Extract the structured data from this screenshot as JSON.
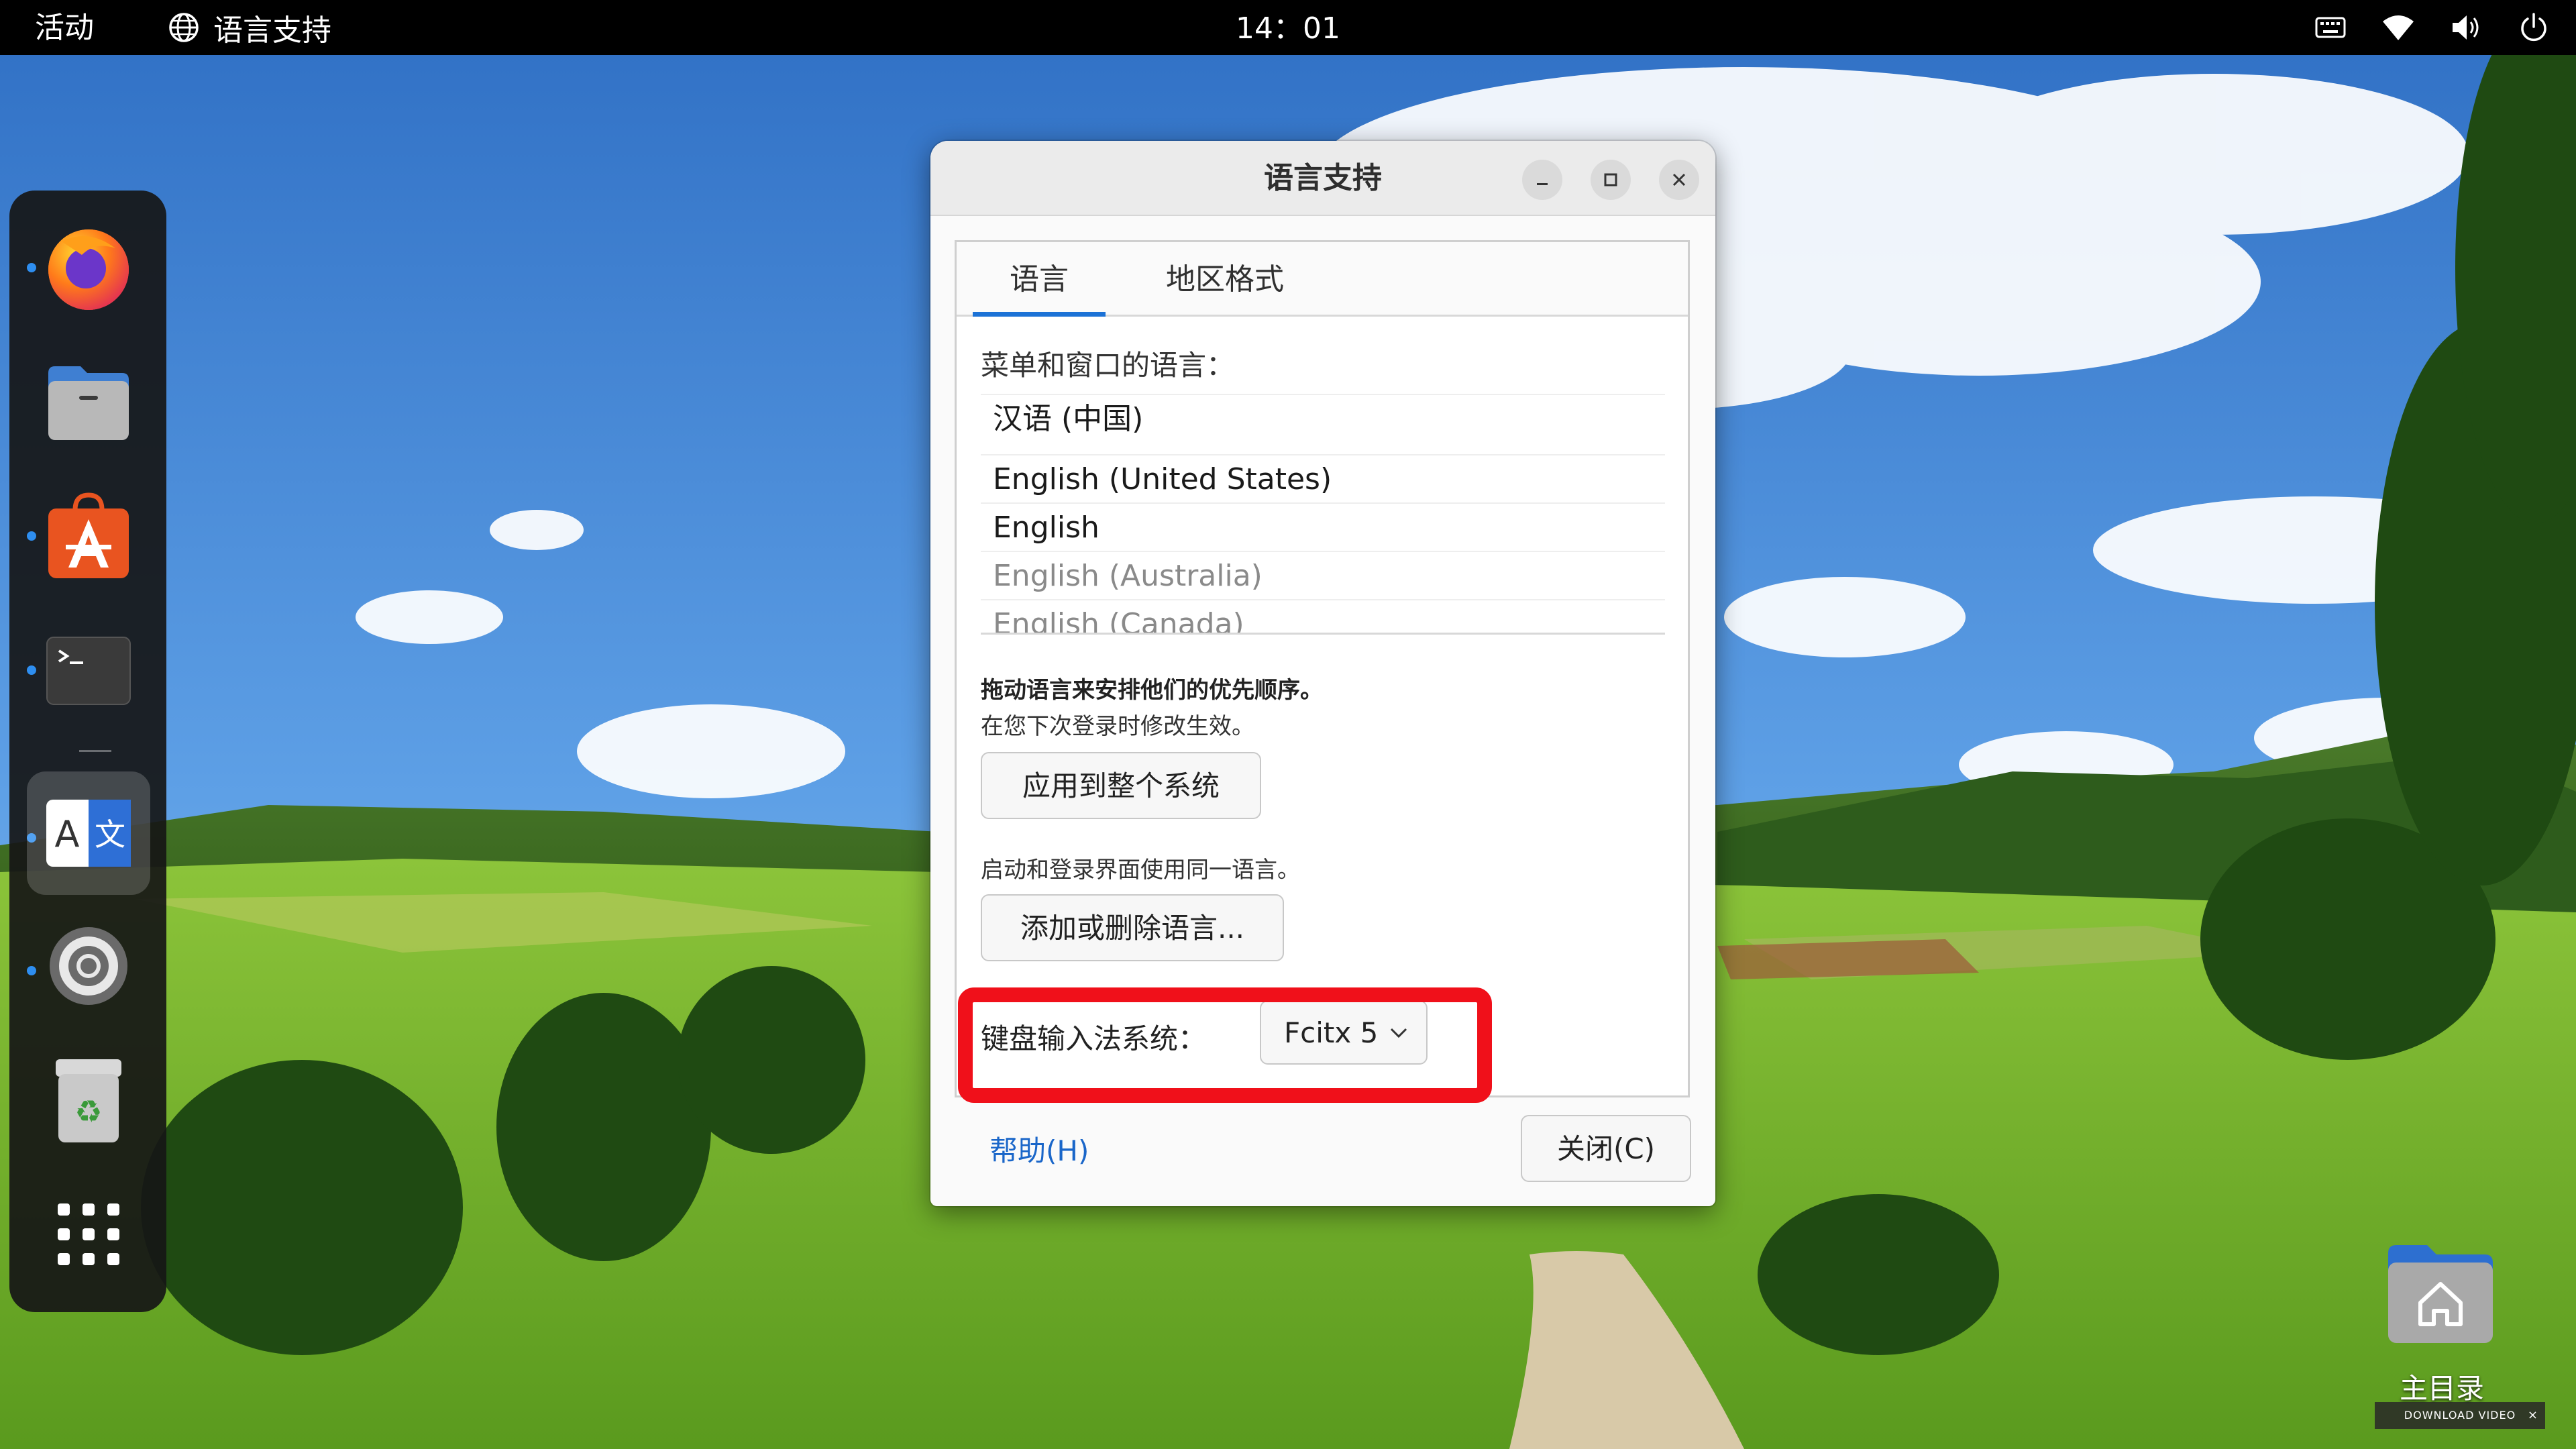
{
  "topbar": {
    "activities": "活动",
    "app_name": "语言支持",
    "clock": "14：01"
  },
  "dock": {
    "apps": [
      {
        "name": "Firefox",
        "icon": "firefox-icon",
        "running": true
      },
      {
        "name": "文件",
        "icon": "files-icon",
        "running": false
      },
      {
        "name": "Ubuntu Software",
        "icon": "app-store-icon",
        "running": true
      },
      {
        "name": "终端",
        "icon": "terminal-icon",
        "running": true
      },
      {
        "name": "语言支持",
        "icon": "language-icon",
        "running": true,
        "active": true
      },
      {
        "name": "设置",
        "icon": "settings-icon",
        "running": true
      },
      {
        "name": "回收站",
        "icon": "trash-icon",
        "running": false
      },
      {
        "name": "显示应用程序",
        "icon": "app-grid-icon",
        "running": false
      }
    ]
  },
  "dialog": {
    "title": "语言支持",
    "tabs": [
      {
        "label": "语言",
        "active": true
      },
      {
        "label": "地区格式",
        "active": false
      }
    ],
    "menu_language_label": "菜单和窗口的语言：",
    "languages": [
      {
        "name": "汉语 (中国)",
        "dim": false
      },
      {
        "name": "English (United States)",
        "dim": false
      },
      {
        "name": "English",
        "dim": false
      },
      {
        "name": "English (Australia)",
        "dim": true
      },
      {
        "name": "English (Canada)",
        "dim": true
      }
    ],
    "drag_hint": "拖动语言来安排他们的优先顺序。",
    "next_login_hint": "在您下次登录时修改生效。",
    "apply_system_button": "应用到整个系统",
    "login_screen_hint": "启动和登录界面使用同一语言。",
    "add_remove_button": "添加或删除语言...",
    "ime_label": "键盘输入法系统：",
    "ime_value": "Fcitx 5",
    "help_link": "帮助(H)",
    "close_button": "关闭(C)"
  },
  "desktop": {
    "home_folder_label": "主目录",
    "watermark": "DOWNLOAD VIDEO",
    "watermark_close": "×"
  },
  "colors": {
    "accent": "#1c72d6",
    "highlight": "#f0101a",
    "topbar": "#000000",
    "running_dot": "#2e8ef0"
  }
}
